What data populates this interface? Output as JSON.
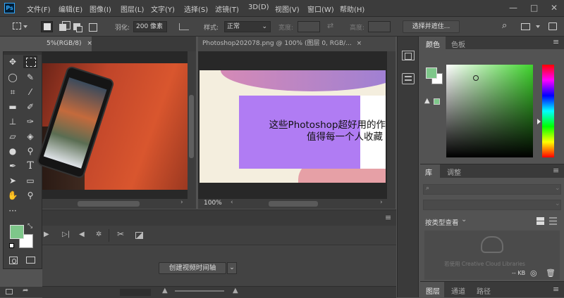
{
  "app": {
    "logo": "Ps"
  },
  "menu": [
    "文件(F)",
    "编辑(E)",
    "图像(I)",
    "图层(L)",
    "文字(Y)",
    "选择(S)",
    "滤镜(T)",
    "3D(D)",
    "视图(V)",
    "窗口(W)",
    "帮助(H)"
  ],
  "window_controls": {
    "minimize": "—",
    "maximize": "□",
    "close": "✕"
  },
  "options": {
    "feather_label": "羽化:",
    "feather_value": "200 像素",
    "style_label": "样式:",
    "style_value": "正常",
    "width_label": "宽度:",
    "height_label": "高度:",
    "select_mask": "选择并遮住..."
  },
  "doc1": {
    "tab_title": "5%(RGB/8)",
    "close": "×"
  },
  "doc2": {
    "tab_title": "Photoshop202078.png @ 100% (图层 0, RGB/...",
    "close": "×",
    "text_line1": "这些Photoshop超好用的作",
    "text_line2": "值得每一个人收藏",
    "zoom": "100%"
  },
  "timeline": {
    "create_button": "创建视频时间轴"
  },
  "color_panel": {
    "tab_color": "颜色",
    "tab_swatches": "色板",
    "fg_color": "#7ec78a",
    "bg_color": "#ffffff"
  },
  "library_panel": {
    "tab_library": "库",
    "tab_adjust": "调整",
    "view_by": "按类型查看",
    "cc_text": "若使用 Creative Cloud Libraries",
    "kb": "-- KB"
  },
  "layers_panel": {
    "tab_layers": "图层",
    "tab_channels": "通道",
    "tab_paths": "路径"
  },
  "colors": {
    "purple_box": "#b07cf3",
    "orange_bg": "#d9562e"
  }
}
